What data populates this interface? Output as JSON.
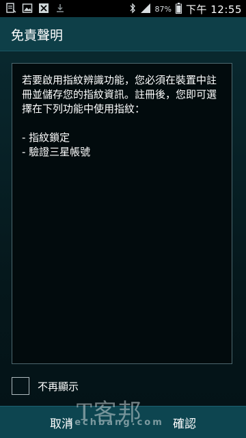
{
  "status_bar": {
    "icons_left": [
      "note-icon",
      "image-icon",
      "usb-icon",
      "download-icon"
    ],
    "icons_right": [
      "bluetooth-icon",
      "signal-icon",
      "battery-icon"
    ],
    "battery": "87%",
    "time": "下午 12:55"
  },
  "title_bar": {
    "title": "免責聲明"
  },
  "content": {
    "paragraph": "若要啟用指紋辨識功能，您必須在裝置中註冊並儲存您的指紋資訊。註冊後，您即可選擇在下列功能中使用指紋：",
    "list": [
      "- 指紋鎖定",
      "- 驗證三星帳號"
    ]
  },
  "checkbox": {
    "label": "不再顯示",
    "checked": false
  },
  "buttons": {
    "cancel": "取消",
    "confirm": "確認"
  },
  "watermark": {
    "big": "T客邦",
    "small": "techbang.com"
  },
  "colors": {
    "title_bar": "#0e3f48",
    "bottom_bar": "#0d4550",
    "panel_border": "#4e6970"
  }
}
